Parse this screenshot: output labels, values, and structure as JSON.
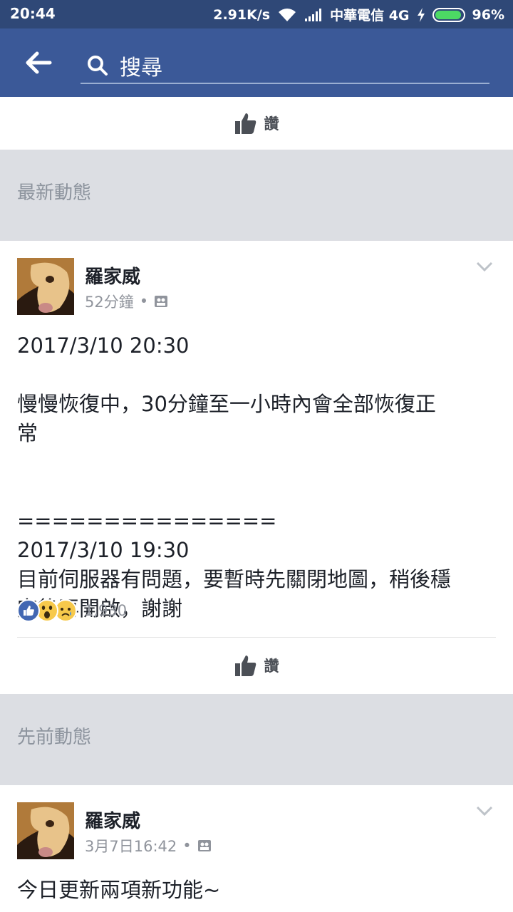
{
  "status_bar": {
    "time": "20:44",
    "speed": "2.91K/s",
    "carrier": "中華電信 4G",
    "battery": "96%",
    "battery_level": 0.96,
    "battery_color": "#4cd964"
  },
  "app_bar": {
    "back_icon": "back-arrow-icon",
    "search_icon": "search-icon",
    "search_placeholder": "搜尋",
    "color": "#3b5998"
  },
  "top_like_bar": {
    "label": "讚",
    "icon": "thumbs-up-icon"
  },
  "sections": {
    "recent": "最新動態",
    "previous": "先前動態"
  },
  "posts": [
    {
      "author": "羅家威",
      "time": "52分鐘",
      "privacy_icon": "public-page-icon",
      "text": "2017/3/10 20:30\n\n慢慢恢復中，30分鐘至一小時內會全部恢復正\n常\n\n\n===============\n2017/3/10 19:30\n目前伺服器有問題，要暫時先關閉地圖，稍後穩\n定後再開啟，謝謝",
      "reactions": [
        "like-reaction-icon",
        "wow-reaction-icon",
        "sad-reaction-icon"
      ],
      "reaction_count": "1,930",
      "like_label": "讚"
    },
    {
      "author": "羅家威",
      "time": "3月7日16:42",
      "privacy_icon": "public-page-icon",
      "text": "今日更新兩項新功能~"
    }
  ]
}
